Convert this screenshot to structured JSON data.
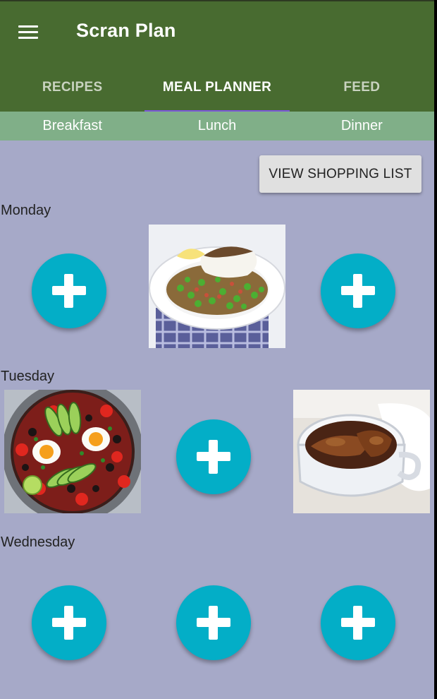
{
  "app": {
    "title": "Scran Plan",
    "menu_icon": "menu-icon"
  },
  "tabs": [
    {
      "label": "RECIPES",
      "active": false
    },
    {
      "label": "MEAL PLANNER",
      "active": true
    },
    {
      "label": "FEED",
      "active": false
    }
  ],
  "meal_types": [
    "Breakfast",
    "Lunch",
    "Dinner"
  ],
  "shopping_button": "VIEW SHOPPING LIST",
  "days": [
    {
      "name": "Monday",
      "meals": [
        "add",
        "fish-with-peas-lentils-photo",
        "add"
      ]
    },
    {
      "name": "Tuesday",
      "meals": [
        "shakshuka-avocado-pan-photo",
        "add",
        "braised-chicken-casserole-photo"
      ]
    },
    {
      "name": "Wednesday",
      "meals": [
        "add",
        "add",
        "add"
      ]
    }
  ],
  "colors": {
    "toolbar": "#486b30",
    "tab_indicator": "#7b57d8",
    "subtab_bar": "#80af88",
    "background": "#a6a9c8",
    "fab": "#03aec7"
  }
}
